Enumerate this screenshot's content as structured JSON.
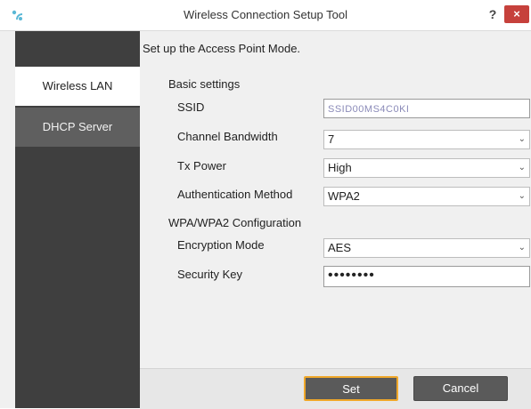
{
  "window": {
    "title": "Wireless Connection Setup Tool",
    "help_label": "?",
    "close_label": "×"
  },
  "sidebar": {
    "items": [
      {
        "label": "Wireless LAN",
        "active": true
      },
      {
        "label": "DHCP Server",
        "active": false
      }
    ]
  },
  "main": {
    "heading": "Set up the Access Point Mode.",
    "basic_section": "Basic settings",
    "ssid": {
      "label": "SSID",
      "value": "SSID00MS4C0KI"
    },
    "channel_bandwidth": {
      "label": "Channel Bandwidth",
      "value": "7"
    },
    "tx_power": {
      "label": "Tx Power",
      "value": "High"
    },
    "auth_method": {
      "label": "Authentication Method",
      "value": "WPA2"
    },
    "wpa_section": "WPA/WPA2 Configuration",
    "encryption_mode": {
      "label": "Encryption Mode",
      "value": "AES"
    },
    "security_key": {
      "label": "Security Key",
      "value": "••••••••"
    }
  },
  "footer": {
    "set_label": "Set",
    "cancel_label": "Cancel"
  },
  "colors": {
    "sidebar_bg": "#3f3f3f",
    "close_button": "#c6413c",
    "focus_border": "#f0a82a"
  }
}
